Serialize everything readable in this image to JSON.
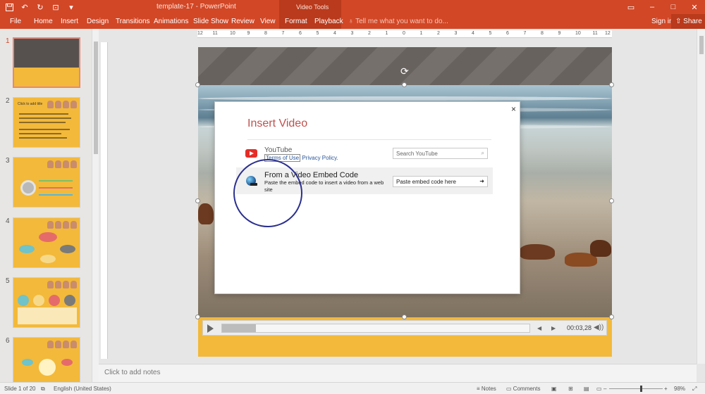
{
  "window": {
    "title": "template-17 - PowerPoint",
    "context_group": "Video Tools"
  },
  "quick_access": [
    {
      "name": "save-icon",
      "glyph": "💾"
    },
    {
      "name": "undo-icon",
      "glyph": "↶"
    },
    {
      "name": "redo-icon",
      "glyph": "↻"
    },
    {
      "name": "start-from-beginning-icon",
      "glyph": "⊡"
    },
    {
      "name": "customize-qat-icon",
      "glyph": "▾"
    }
  ],
  "ribbon": {
    "tabs": [
      {
        "label": "File"
      },
      {
        "label": "Home"
      },
      {
        "label": "Insert"
      },
      {
        "label": "Design"
      },
      {
        "label": "Transitions"
      },
      {
        "label": "Animations"
      },
      {
        "label": "Slide Show"
      },
      {
        "label": "Review"
      },
      {
        "label": "View"
      },
      {
        "label": "Format"
      },
      {
        "label": "Playback"
      }
    ],
    "tell_me": "Tell me what you want to do...",
    "sign_in": "Sign in",
    "share": "Share"
  },
  "slides": [
    {
      "number": "1",
      "active": true
    },
    {
      "number": "2",
      "title": "Click to add title"
    },
    {
      "number": "3"
    },
    {
      "number": "4"
    },
    {
      "number": "5"
    },
    {
      "number": "6"
    }
  ],
  "ruler": {
    "numbers": [
      "12",
      "11",
      "10",
      "9",
      "8",
      "7",
      "6",
      "5",
      "4",
      "3",
      "2",
      "1",
      "0",
      "1",
      "2",
      "3",
      "4",
      "5",
      "6",
      "7",
      "8",
      "9",
      "10",
      "11",
      "12"
    ]
  },
  "video_controls": {
    "progress": 0.11,
    "time": "00:03,28"
  },
  "dialog": {
    "title": "Insert Video",
    "close": "×",
    "youtube": {
      "name": "YouTube",
      "terms": "Terms of Use",
      "privacy": " Privacy Policy.",
      "search_placeholder": "Search YouTube"
    },
    "embed": {
      "title": "From a Video Embed Code",
      "description": "Paste the embed code to insert a video from a web site",
      "placeholder": "Paste embed code here"
    }
  },
  "notes": {
    "placeholder": "Click to add notes"
  },
  "status_bar": {
    "slide_info": "Slide 1 of 20",
    "language": "English (United States)",
    "notes": "Notes",
    "comments": "Comments",
    "zoom": "98%"
  },
  "colors": {
    "accent": "#d24726",
    "slide_yellow": "#f3b93a",
    "dialog_title": "#c0504d",
    "annotation": "#2a2f8f"
  }
}
